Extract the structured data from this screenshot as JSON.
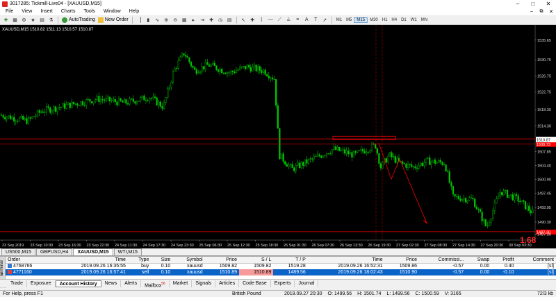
{
  "window": {
    "title": "3017285: Tickmill-Live04 - [XAUUSD,M15]"
  },
  "menu": [
    "File",
    "View",
    "Insert",
    "Charts",
    "Tools",
    "Window",
    "Help"
  ],
  "toolbar": {
    "autotrading_label": "AutoTrading",
    "new_order_label": "New Order",
    "timeframes": [
      "M1",
      "M5",
      "M15",
      "M30",
      "H1",
      "H4",
      "D1",
      "W1",
      "MN"
    ],
    "active_timeframe": "M15"
  },
  "chart": {
    "header": "XAUUSD,M15  1510.82 1511.13 1510.57 1510.87",
    "price_labels": [
      "1535.65",
      "1530.75",
      "1526.75",
      "1522.75",
      "1518.30",
      "1514.30",
      "1510.87",
      "1507.85",
      "1504.40",
      "1500.90",
      "1497.45",
      "1493.95",
      "1490.30",
      "1487.30"
    ],
    "current_price": "1510.87",
    "red_level_label": "1509.73",
    "lower_level_label": "1487.30",
    "pips_label": "1.68",
    "time_labels": [
      "23 Sep 2019",
      "23 Sep 10:30",
      "23 Sep 16:30",
      "23 Sep 22:30",
      "24 Sep 11:30",
      "24 Sep 17:30",
      "24 Sep 23:30",
      "25 Sep 06:30",
      "25 Sep 12:30",
      "25 Sep 18:30",
      "26 Sep 01:30",
      "26 Sep 07:30",
      "26 Sep 13:30",
      "26 Sep 19:30",
      "27 Sep 02:30",
      "27 Sep 08:30",
      "27 Sep 14:30",
      "27 Sep 20:30",
      "30 Sep 03:30"
    ],
    "colors": {
      "bg": "#000000",
      "bull": "#00c800",
      "bear": "#00c800",
      "level": "#ff0000"
    }
  },
  "chart_tabs": [
    {
      "label": "US500,M15",
      "active": false
    },
    {
      "label": "GBPUSD,H4",
      "active": false
    },
    {
      "label": "XAUUSD,M15",
      "active": true
    },
    {
      "label": "WTI,M15",
      "active": false
    }
  ],
  "terminal": {
    "side_label": "Terminal",
    "columns": [
      "Order",
      "Time",
      "Type",
      "Size",
      "Symbol",
      "Price",
      "S / L",
      "T / P",
      "Time",
      "Price",
      "Commissi...",
      "Swap",
      "Profit",
      "Comment"
    ],
    "rows": [
      {
        "order": "4768766",
        "time": "2019.09.26 16:35:55",
        "type": "buy",
        "size": "0.10",
        "symbol": "xauusd",
        "price": "1509.82",
        "sl": "1509.82",
        "tp": "1519.28",
        "ctime": "2019.09.26 16:52:31",
        "cprice": "1509.86",
        "commission": "-0.57",
        "swap": "0.00",
        "profit": "0.40",
        "comment": "[sl]",
        "selected": false
      },
      {
        "order": "4771160",
        "time": "2019.09.26 16:57:41",
        "type": "sell",
        "size": "0.10",
        "symbol": "xauusd",
        "price": "1510.89",
        "sl": "1510.89",
        "tp": "1489.56",
        "ctime": "2019.09.26 18:02:43",
        "cprice": "1510.90",
        "commission": "-0.57",
        "swap": "0.00",
        "profit": "-0.10",
        "comment": "[sl]",
        "selected": true
      }
    ],
    "tabs": [
      {
        "label": "Trade",
        "active": false
      },
      {
        "label": "Exposure",
        "active": false
      },
      {
        "label": "Account History",
        "active": true
      },
      {
        "label": "News",
        "active": false
      },
      {
        "label": "Alerts",
        "active": false
      },
      {
        "label": "Mailbox",
        "badge": "56",
        "active": false
      },
      {
        "label": "Market",
        "active": false
      },
      {
        "label": "Signals",
        "active": false
      },
      {
        "label": "Articles",
        "active": false
      },
      {
        "label": "Code Base",
        "active": false
      },
      {
        "label": "Experts",
        "active": false
      },
      {
        "label": "Journal",
        "active": false
      }
    ]
  },
  "status": {
    "help": "For Help, press F1",
    "profile": "British Pound",
    "datetime": "2019.09.27 20:30",
    "open": "O: 1499.56",
    "high": "H: 1501.74",
    "low": "L: 1499.56",
    "close": "C: 1500.59",
    "volume": "V: 3165",
    "traffic": "72/3 kb"
  }
}
